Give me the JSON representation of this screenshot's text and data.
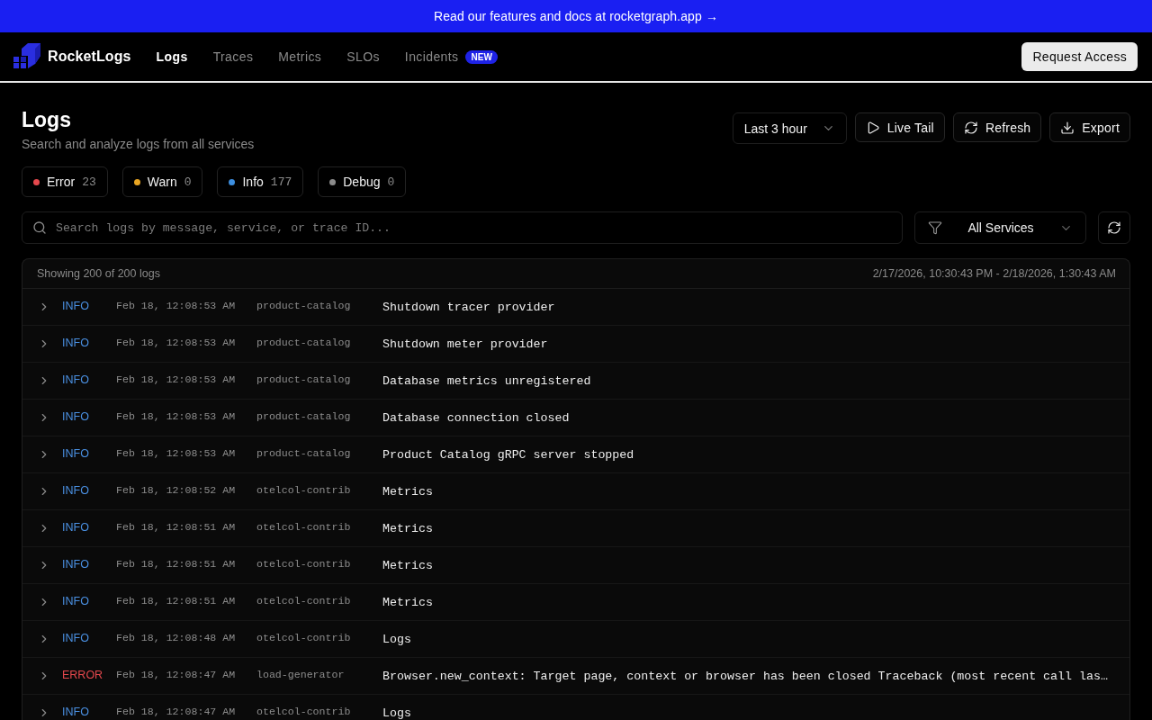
{
  "banner": {
    "text": "Read our features and docs at rocketgraph.app →"
  },
  "nav": {
    "brand": "RocketLogs",
    "items": [
      {
        "label": "Logs",
        "selected": true
      },
      {
        "label": "Traces",
        "selected": false
      },
      {
        "label": "Metrics",
        "selected": false
      },
      {
        "label": "SLOs",
        "selected": false
      },
      {
        "label": "Incidents",
        "selected": false,
        "badge": "NEW"
      }
    ],
    "action": "Request Access"
  },
  "page": {
    "title": "Logs",
    "subtitle": "Search and analyze logs from all services"
  },
  "toolbar": {
    "time_range": "Last 3 hour",
    "buttons": [
      {
        "kind": "play",
        "label": "Live Tail"
      },
      {
        "kind": "refresh",
        "label": "Refresh"
      },
      {
        "kind": "download",
        "label": "Export"
      }
    ]
  },
  "level_filters": [
    {
      "label": "Error",
      "count": "23",
      "color": "#e5484d"
    },
    {
      "label": "Warn",
      "count": "0",
      "color": "#e9a623"
    },
    {
      "label": "Info",
      "count": "177",
      "color": "#3d8fe0"
    },
    {
      "label": "Debug",
      "count": "0",
      "color": "#8b8b8b"
    }
  ],
  "search": {
    "placeholder": "Search logs by message, service, or trace ID..."
  },
  "service_filter": {
    "value": "All Services"
  },
  "table": {
    "summary": "Showing 200 of 200 logs",
    "range": "2/17/2026, 10:30:43 PM - 2/18/2026, 1:30:43 AM",
    "rows": [
      {
        "expanded": false,
        "severity": "INFO",
        "color": "#4a90e2",
        "time": "Feb 18, 12:08:53 AM",
        "service": "product-catalog",
        "message": "Shutdown tracer provider"
      },
      {
        "expanded": false,
        "severity": "INFO",
        "color": "#4a90e2",
        "time": "Feb 18, 12:08:53 AM",
        "service": "product-catalog",
        "message": "Shutdown meter provider"
      },
      {
        "expanded": false,
        "severity": "INFO",
        "color": "#4a90e2",
        "time": "Feb 18, 12:08:53 AM",
        "service": "product-catalog",
        "message": "Database metrics unregistered"
      },
      {
        "expanded": false,
        "severity": "INFO",
        "color": "#4a90e2",
        "time": "Feb 18, 12:08:53 AM",
        "service": "product-catalog",
        "message": "Database connection closed"
      },
      {
        "expanded": false,
        "severity": "INFO",
        "color": "#4a90e2",
        "time": "Feb 18, 12:08:53 AM",
        "service": "product-catalog",
        "message": "Product Catalog gRPC server stopped"
      },
      {
        "expanded": false,
        "severity": "INFO",
        "color": "#4a90e2",
        "time": "Feb 18, 12:08:52 AM",
        "service": "otelcol-contrib",
        "message": "Metrics"
      },
      {
        "expanded": false,
        "severity": "INFO",
        "color": "#4a90e2",
        "time": "Feb 18, 12:08:51 AM",
        "service": "otelcol-contrib",
        "message": "Metrics"
      },
      {
        "expanded": false,
        "severity": "INFO",
        "color": "#4a90e2",
        "time": "Feb 18, 12:08:51 AM",
        "service": "otelcol-contrib",
        "message": "Metrics"
      },
      {
        "expanded": false,
        "severity": "INFO",
        "color": "#4a90e2",
        "time": "Feb 18, 12:08:51 AM",
        "service": "otelcol-contrib",
        "message": "Metrics"
      },
      {
        "expanded": false,
        "severity": "INFO",
        "color": "#4a90e2",
        "time": "Feb 18, 12:08:48 AM",
        "service": "otelcol-contrib",
        "message": "Logs"
      },
      {
        "expanded": false,
        "severity": "ERROR",
        "color": "#e5484d",
        "time": "Feb 18, 12:08:47 AM",
        "service": "load-generator",
        "message": "Browser.new_context: Target page, context or browser has been closed Traceback (most recent call las…"
      },
      {
        "expanded": false,
        "severity": "INFO",
        "color": "#4a90e2",
        "time": "Feb 18, 12:08:47 AM",
        "service": "otelcol-contrib",
        "message": "Logs"
      }
    ]
  }
}
